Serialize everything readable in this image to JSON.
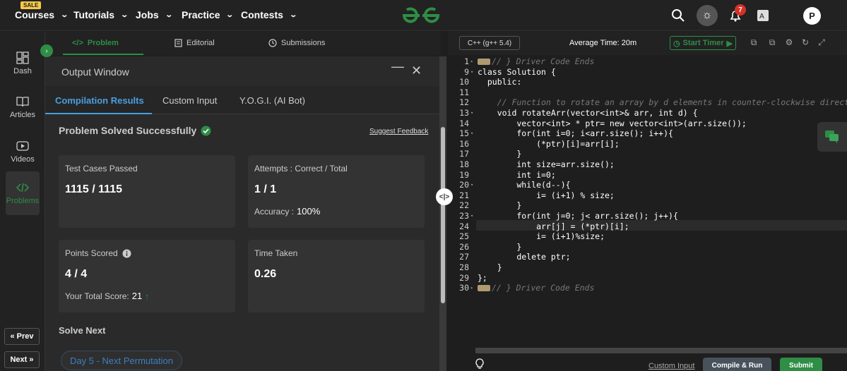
{
  "topnav": {
    "sale_badge": "SALE",
    "items": [
      {
        "label": "Courses"
      },
      {
        "label": "Tutorials"
      },
      {
        "label": "Jobs"
      },
      {
        "label": "Practice"
      },
      {
        "label": "Contests"
      }
    ],
    "notification_count": "7",
    "avatar_initial": "P",
    "brand_color": "#2f8d46"
  },
  "sidebar": {
    "items": [
      {
        "label": "Dash",
        "icon": "dashboard-icon"
      },
      {
        "label": "Articles",
        "icon": "book-icon"
      },
      {
        "label": "Videos",
        "icon": "video-icon"
      },
      {
        "label": "Problems",
        "icon": "code-icon"
      }
    ],
    "prev_label": "Prev",
    "next_label": "Next"
  },
  "problem_tabs": {
    "problem": "Problem",
    "editorial": "Editorial",
    "submissions": "Submissions"
  },
  "output": {
    "title": "Output Window",
    "tabs": [
      "Compilation Results",
      "Custom Input",
      "Y.O.G.I. (AI Bot)"
    ],
    "status": "Problem Solved Successfully",
    "feedback": "Suggest Feedback",
    "test_cases_label": "Test Cases Passed",
    "test_cases_value": "1115 / 1115",
    "attempts_label": "Attempts : Correct / Total",
    "attempts_value": "1 / 1",
    "accuracy_label": "Accuracy :",
    "accuracy_value": "100%",
    "points_label": "Points Scored",
    "points_value": "4 / 4",
    "total_score_label": "Your Total Score:",
    "total_score_value": "21",
    "time_label": "Time Taken",
    "time_value": "0.26",
    "solve_next": "Solve Next",
    "next_problem": "Day 5 - Next Permutation"
  },
  "editor": {
    "language": "C++ (g++ 5.4)",
    "avg_time": "Average Time: 20m",
    "start_timer": "Start Timer",
    "custom_input": "Custom Input",
    "compile_run": "Compile & Run",
    "submit": "Submit",
    "lines": [
      {
        "n": "1",
        "text": "// } Driver Code Ends",
        "type": "fold"
      },
      {
        "n": "9",
        "text": "class Solution {",
        "type": "code"
      },
      {
        "n": "10",
        "text": "  public:",
        "type": "code"
      },
      {
        "n": "11",
        "text": "",
        "type": "code"
      },
      {
        "n": "12",
        "text": "    // Function to rotate an array by d elements in counter-clockwise direction.",
        "type": "comment"
      },
      {
        "n": "13",
        "text": "    void rotateArr(vector<int>& arr, int d) {",
        "type": "code"
      },
      {
        "n": "14",
        "text": "        vector<int> * ptr= new vector<int>(arr.size());",
        "type": "code"
      },
      {
        "n": "15",
        "text": "        for(int i=0; i<arr.size(); i++){",
        "type": "code"
      },
      {
        "n": "16",
        "text": "            (*ptr)[i]=arr[i];",
        "type": "code"
      },
      {
        "n": "17",
        "text": "        }",
        "type": "code"
      },
      {
        "n": "18",
        "text": "        int size=arr.size();",
        "type": "code"
      },
      {
        "n": "19",
        "text": "        int i=0;",
        "type": "code"
      },
      {
        "n": "20",
        "text": "        while(d--){",
        "type": "code"
      },
      {
        "n": "21",
        "text": "            i= (i+1) % size;",
        "type": "code"
      },
      {
        "n": "22",
        "text": "        }",
        "type": "code"
      },
      {
        "n": "23",
        "text": "        for(int j=0; j< arr.size(); j++){",
        "type": "code"
      },
      {
        "n": "24",
        "text": "            arr[j] = (*ptr)[i];",
        "type": "code"
      },
      {
        "n": "25",
        "text": "            i= (i+1)%size;",
        "type": "code"
      },
      {
        "n": "26",
        "text": "        }",
        "type": "code"
      },
      {
        "n": "27",
        "text": "        delete ptr;",
        "type": "code"
      },
      {
        "n": "28",
        "text": "    }",
        "type": "code"
      },
      {
        "n": "29",
        "text": "};",
        "type": "code"
      },
      {
        "n": "30",
        "text": "// } Driver Code Ends",
        "type": "fold"
      }
    ]
  }
}
